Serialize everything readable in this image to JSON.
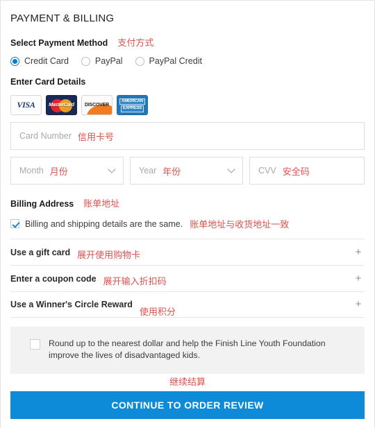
{
  "page": {
    "title": "PAYMENT & BILLING",
    "accent_blue": "#0d8bd9",
    "annotation_red": "#d9534f"
  },
  "payment_method": {
    "label": "Select Payment Method",
    "annotation": "支付方式",
    "options": [
      {
        "label": "Credit Card",
        "selected": true
      },
      {
        "label": "PayPal",
        "selected": false
      },
      {
        "label": "PayPal Credit",
        "selected": false
      }
    ]
  },
  "card_details": {
    "label": "Enter Card Details",
    "accepted_cards": [
      {
        "name": "visa-card-icon",
        "text": "VISA"
      },
      {
        "name": "mastercard-card-icon",
        "text": "MasterCard"
      },
      {
        "name": "discover-card-icon",
        "text": "DISCOVER"
      },
      {
        "name": "amex-card-icon",
        "line1": "AMERICAN",
        "line2": "EXPRESS"
      }
    ],
    "card_number": {
      "placeholder": "Card Number",
      "annotation": "信用卡号",
      "value": ""
    },
    "month": {
      "placeholder": "Month",
      "annotation": "月份",
      "value": ""
    },
    "year": {
      "placeholder": "Year",
      "annotation": "年份",
      "value": ""
    },
    "cvv": {
      "placeholder": "CVV",
      "annotation": "安全码",
      "value": ""
    }
  },
  "billing_address": {
    "label": "Billing Address",
    "annotation": "账单地址",
    "same_as_shipping": {
      "label": "Billing and shipping details are the same.",
      "annotation": "账单地址与收货地址一致",
      "checked": true
    }
  },
  "accordions": [
    {
      "label": "Use a gift card",
      "annotation": "展开使用购物卡",
      "icon": "plus-icon",
      "icon_glyph": "+"
    },
    {
      "label": "Enter a coupon code",
      "annotation": "展开输入折扣码",
      "icon": "plus-icon",
      "icon_glyph": "+"
    },
    {
      "label": "Use a Winner's Circle Reward",
      "annotation": "使用积分",
      "icon": "plus-icon",
      "icon_glyph": "+"
    }
  ],
  "round_up": {
    "text": "Round up to the nearest dollar and help the Finish Line Youth Foundation improve the lives of disadvantaged kids.",
    "checked": false
  },
  "cta": {
    "label": "CONTINUE TO ORDER REVIEW",
    "annotation": "继续结算"
  }
}
